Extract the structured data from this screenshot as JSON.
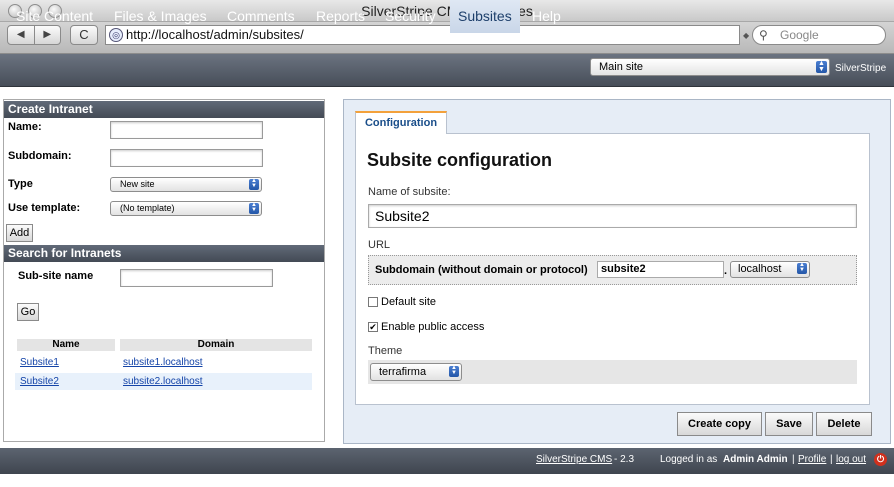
{
  "window": {
    "title": "SilverStripe CMS | Subsites"
  },
  "browser": {
    "url": "http://localhost/admin/subsites/",
    "search_placeholder": "Google",
    "back_icon": "◀",
    "forward_icon": "▶",
    "reload_icon": "C"
  },
  "menu": {
    "items": [
      "Site Content",
      "Files & Images",
      "Comments",
      "Reports",
      "Security",
      "Subsites",
      "Help"
    ],
    "active": "Subsites",
    "site_select": "Main site",
    "brand": "SilverStripe"
  },
  "create_intranet": {
    "heading": "Create Intranet",
    "name_label": "Name:",
    "subdomain_label": "Subdomain:",
    "type_label": "Type",
    "type_value": "New site",
    "template_label": "Use template:",
    "template_value": "(No template)",
    "add_button": "Add"
  },
  "search_intranets": {
    "heading": "Search for Intranets",
    "subsite_name_label": "Sub-site name",
    "go_button": "Go",
    "columns": [
      "Name",
      "Domain"
    ],
    "rows": [
      {
        "name": "Subsite1",
        "domain": "subsite1.localhost"
      },
      {
        "name": "Subsite2",
        "domain": "subsite2.localhost"
      }
    ]
  },
  "config": {
    "tab_label": "Configuration",
    "heading": "Subsite configuration",
    "name_label": "Name of subsite:",
    "name_value": "Subsite2",
    "url_label": "URL",
    "subdomain_label": "Subdomain (without domain or protocol)",
    "subdomain_value": "subsite2",
    "dot": ".",
    "domain_value": "localhost",
    "default_site_label": "Default site",
    "public_access_label": "Enable public access",
    "check_mark": "✔",
    "theme_label": "Theme",
    "theme_value": "terrafirma",
    "buttons": {
      "create_copy": "Create copy",
      "save": "Save",
      "delete": "Delete"
    }
  },
  "footer": {
    "cms_link": "SilverStripe CMS",
    "version": "-  2.3",
    "logged_in_prefix": "Logged in as",
    "user": "Admin Admin",
    "sep": "|",
    "profile_link": "Profile",
    "logout_link": "log out"
  }
}
